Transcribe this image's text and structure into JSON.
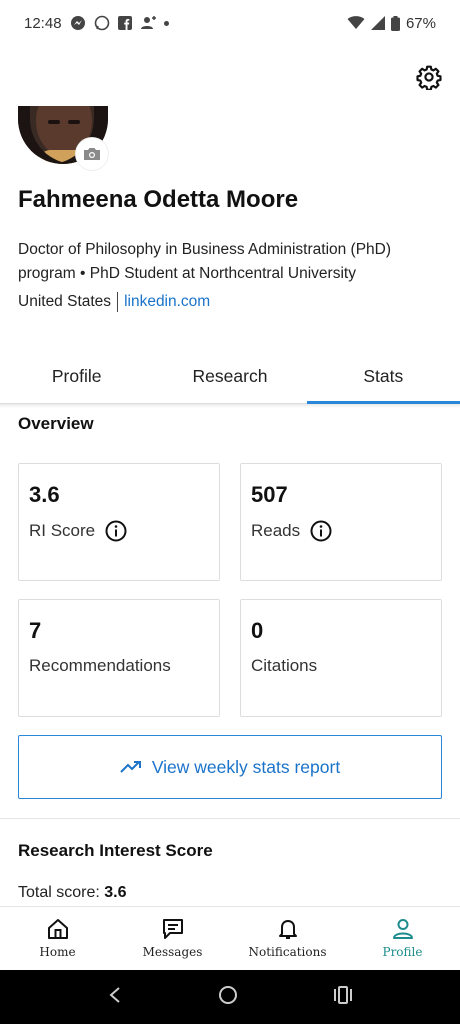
{
  "status_bar": {
    "time": "12:48",
    "battery": "67%"
  },
  "profile": {
    "name": "Fahmeena Odetta Moore",
    "headline": "Doctor of Philosophy in Business Administration (PhD) program • PhD Student at Northcentral University",
    "location": "United States",
    "website": "linkedin.com"
  },
  "tabs": [
    {
      "label": "Profile"
    },
    {
      "label": "Research"
    },
    {
      "label": "Stats",
      "active": true
    }
  ],
  "overview": {
    "title": "Overview",
    "stats": [
      {
        "value": "3.6",
        "label": "RI Score",
        "info": true
      },
      {
        "value": "507",
        "label": "Reads",
        "info": true
      },
      {
        "value": "7",
        "label": "Recommendations",
        "info": false
      },
      {
        "value": "0",
        "label": "Citations",
        "info": false
      }
    ],
    "weekly_button": "View weekly stats report"
  },
  "ri_score": {
    "title": "Research Interest Score",
    "total_label": "Total score:",
    "total_value": "3.6"
  },
  "bottom_nav": [
    {
      "label": "Home",
      "icon": "home-icon"
    },
    {
      "label": "Messages",
      "icon": "messages-icon"
    },
    {
      "label": "Notifications",
      "icon": "bell-icon"
    },
    {
      "label": "Profile",
      "icon": "person-icon",
      "active": true
    }
  ],
  "colors": {
    "accent": "#2a86d6",
    "link": "#1a73c9",
    "active_nav": "#1e8c8c"
  }
}
